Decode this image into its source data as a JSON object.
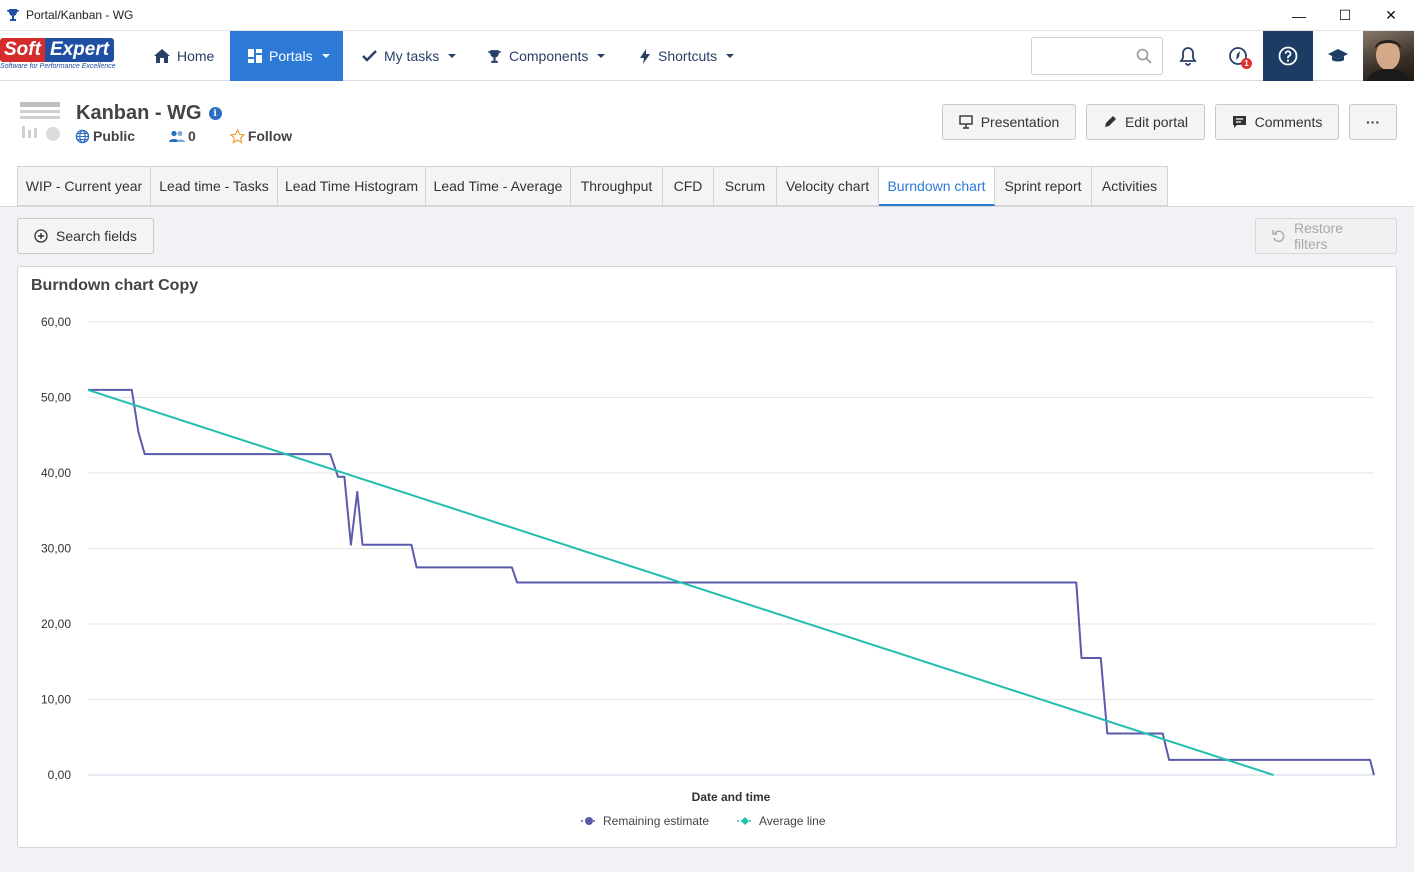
{
  "window": {
    "title": "Portal/Kanban - WG"
  },
  "logo": {
    "soft": "Soft",
    "expert": "Expert",
    "tagline": "Software for Performance Excellence"
  },
  "nav": {
    "home": "Home",
    "portals": "Portals",
    "my_tasks": "My tasks",
    "components": "Components",
    "shortcuts": "Shortcuts"
  },
  "header": {
    "search_placeholder": "",
    "notification_badge": "1"
  },
  "portal": {
    "title": "Kanban - WG",
    "visibility": "Public",
    "members": "0",
    "follow": "Follow",
    "buttons": {
      "presentation": "Presentation",
      "edit": "Edit portal",
      "comments": "Comments",
      "more": "···"
    }
  },
  "tabs": [
    "WIP - Current year",
    "Lead time - Tasks",
    "Lead Time Histogram",
    "Lead Time - Average",
    "Throughput",
    "CFD",
    "Scrum",
    "Velocity chart",
    "Burndown chart",
    "Sprint report",
    "Activities"
  ],
  "active_tab": "Burndown chart",
  "filters": {
    "search_fields": "Search fields",
    "restore_filters": "Restore filters"
  },
  "colors": {
    "accent": "#2c7ad6",
    "nav_dark": "#1d3c64",
    "remaining": "#5b5bab",
    "average": "#22bfb0"
  },
  "chart_data": {
    "type": "line",
    "title": "Burndown chart Copy",
    "xlabel": "Date and time",
    "ylabel": "",
    "ylim": [
      0,
      60
    ],
    "yticks": [
      "0,00",
      "10,00",
      "20,00",
      "30,00",
      "40,00",
      "50,00",
      "60,00"
    ],
    "grid": true,
    "legend_position": "bottom",
    "series": [
      {
        "name": "Remaining estimate",
        "x": [
          0,
          3.4,
          3.9,
          4.4,
          18.8,
          19.4,
          19.9,
          20.4,
          20.9,
          21.3,
          25.1,
          25.5,
          32.9,
          33.3,
          76.7,
          77.1,
          78.6,
          79.1,
          83.4,
          83.9,
          99.5,
          99.8
        ],
        "values": [
          51,
          51,
          45.5,
          42.5,
          42.5,
          39.5,
          39.5,
          30.5,
          37.5,
          30.5,
          30.5,
          27.5,
          27.5,
          25.5,
          25.5,
          15.5,
          15.5,
          5.5,
          5.5,
          2,
          2,
          0
        ]
      },
      {
        "name": "Average line",
        "x": [
          0,
          92
        ],
        "values": [
          51,
          0
        ]
      }
    ]
  }
}
